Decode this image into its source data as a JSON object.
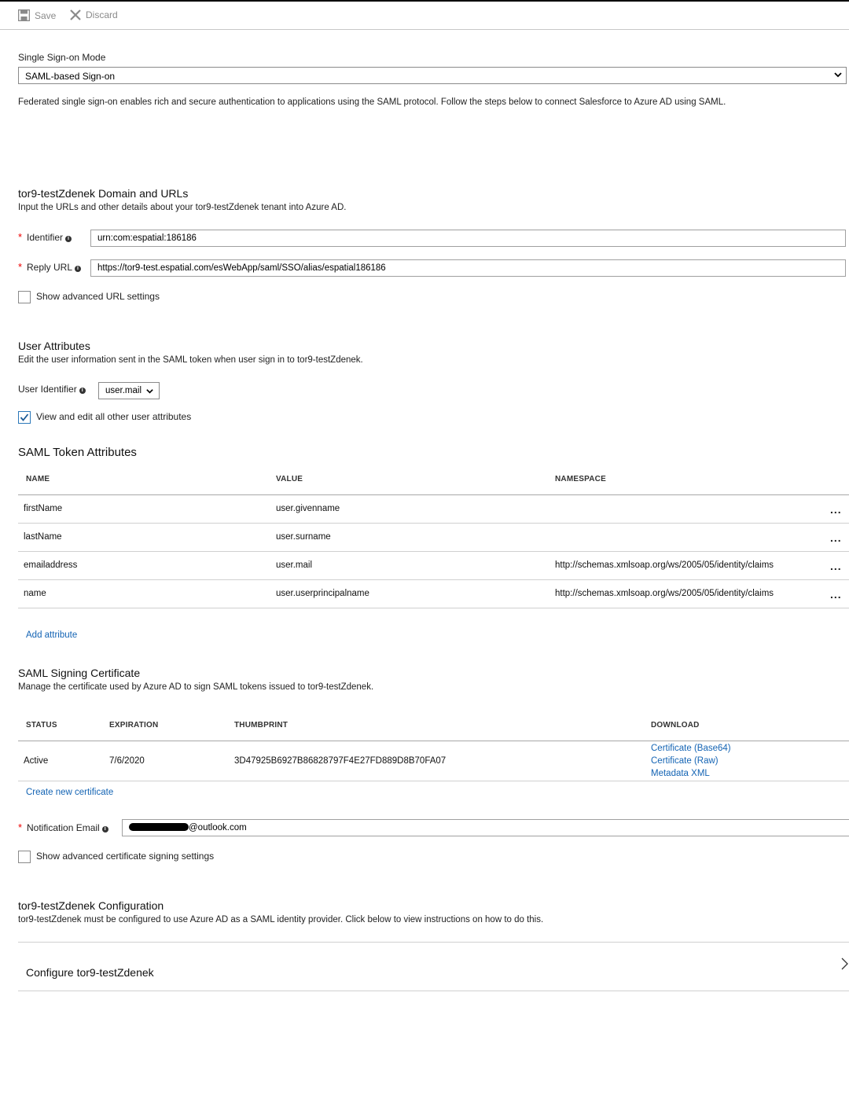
{
  "toolbar": {
    "save_label": "Save",
    "discard_label": "Discard"
  },
  "sso_mode": {
    "label": "Single Sign-on Mode",
    "selected": "SAML-based Sign-on",
    "description": "Federated single sign-on enables rich and secure authentication to applications using the SAML protocol. Follow the steps below to connect Salesforce to Azure AD using SAML."
  },
  "domain_urls": {
    "title": "tor9-testZdenek Domain and URLs",
    "description": "Input the URLs and other details about your tor9-testZdenek tenant into Azure AD.",
    "identifier_label": "Identifier",
    "identifier_value": "urn:com:espatial:186186",
    "reply_url_label": "Reply URL",
    "reply_url_value": "https://tor9-test.espatial.com/esWebApp/saml/SSO/alias/espatial186186",
    "advanced_label": "Show advanced URL settings"
  },
  "user_attributes": {
    "title": "User Attributes",
    "description": "Edit the user information sent in the SAML token when user sign in to tor9-testZdenek.",
    "identifier_label": "User Identifier",
    "identifier_value": "user.mail",
    "view_edit_label": "View and edit all other user attributes"
  },
  "saml_token": {
    "title": "SAML Token Attributes",
    "columns": [
      "NAME",
      "VALUE",
      "NAMESPACE"
    ],
    "rows": [
      {
        "name": "firstName",
        "value": "user.givenname",
        "namespace": ""
      },
      {
        "name": "lastName",
        "value": "user.surname",
        "namespace": ""
      },
      {
        "name": "emailaddress",
        "value": "user.mail",
        "namespace": "http://schemas.xmlsoap.org/ws/2005/05/identity/claims"
      },
      {
        "name": "name",
        "value": "user.userprincipalname",
        "namespace": "http://schemas.xmlsoap.org/ws/2005/05/identity/claims"
      }
    ],
    "more_label": "...",
    "add_label": "Add attribute"
  },
  "certificate": {
    "title": "SAML Signing Certificate",
    "description": "Manage the certificate used by Azure AD to sign SAML tokens issued to tor9-testZdenek.",
    "columns": [
      "STATUS",
      "EXPIRATION",
      "THUMBPRINT",
      "DOWNLOAD"
    ],
    "status": "Active",
    "expiration": "7/6/2020",
    "thumbprint": "3D47925B6927B86828797F4E27FD889D8B70FA07",
    "downloads": [
      "Certificate (Base64)",
      "Certificate (Raw)",
      "Metadata XML"
    ],
    "create_label": "Create new certificate",
    "email_label": "Notification Email",
    "email_value": "@outlook.com",
    "advanced_label": "Show advanced certificate signing settings"
  },
  "configuration": {
    "title": "tor9-testZdenek Configuration",
    "description": "tor9-testZdenek must be configured to use Azure AD as a SAML identity provider. Click below to view instructions on how to do this.",
    "configure_label": "Configure tor9-testZdenek"
  },
  "colors": {
    "link": "#1464b4",
    "required": "#e00000",
    "checkbox_accent": "#2b78b9"
  }
}
